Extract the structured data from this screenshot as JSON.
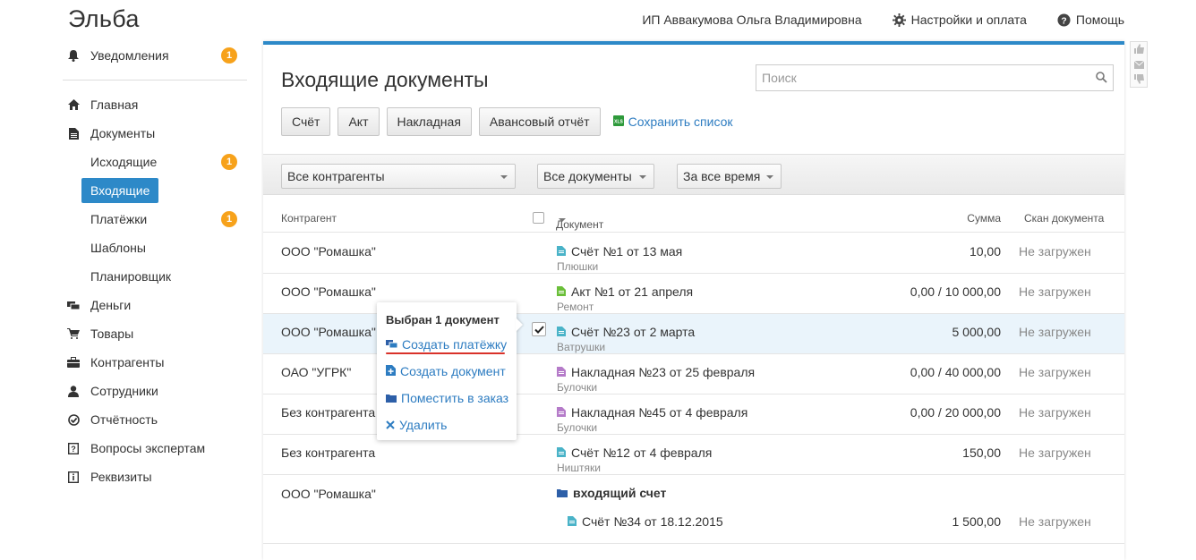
{
  "app": {
    "title": "Эльба"
  },
  "header": {
    "user_name": "ИП Аввакумова Ольга Владимировна",
    "settings_label": "Настройки и оплата",
    "help_label": "Помощь"
  },
  "sidebar": {
    "notifications": {
      "label": "Уведомления",
      "badge": "1"
    },
    "items": [
      {
        "label": "Главная",
        "icon": "home-icon"
      },
      {
        "label": "Документы",
        "icon": "document-icon"
      },
      {
        "label": "Исходящие",
        "badge": "1"
      },
      {
        "label": "Входящие",
        "active": true
      },
      {
        "label": "Платёжки",
        "badge": "1"
      },
      {
        "label": "Шаблоны"
      },
      {
        "label": "Планировщик"
      },
      {
        "label": "Деньги",
        "icon": "money-icon"
      },
      {
        "label": "Товары",
        "icon": "cart-icon"
      },
      {
        "label": "Контрагенты",
        "icon": "briefcase-icon"
      },
      {
        "label": "Сотрудники",
        "icon": "person-icon"
      },
      {
        "label": "Отчётность",
        "icon": "report-icon"
      },
      {
        "label": "Вопросы экспертам",
        "icon": "question-icon"
      },
      {
        "label": "Реквизиты",
        "icon": "info-icon"
      }
    ]
  },
  "main": {
    "title": "Входящие документы",
    "search_placeholder": "Поиск",
    "create_buttons": [
      "Счёт",
      "Акт",
      "Накладная",
      "Авансовый отчёт"
    ],
    "save_list_label": "Сохранить список",
    "filters": {
      "counterparty": "Все контрагенты",
      "documents": "Все документы",
      "period": "За все время"
    },
    "table": {
      "headers": {
        "counterparty": "Контрагент",
        "document": "Документ",
        "sum": "Сумма",
        "scan": "Скан документа"
      },
      "rows": [
        {
          "counterparty": "ООО \"Ромашка\"",
          "doc": "Счёт №1 от 13 мая",
          "desc": "Плюшки",
          "sum": "10,00",
          "scan": "Не загружен",
          "type": "invoice"
        },
        {
          "counterparty": "ООО \"Ромашка\"",
          "doc": "Акт №1 от 21 апреля",
          "desc": "Ремонт",
          "sum": "0,00 / 10 000,00",
          "scan": "Не загружен",
          "type": "act"
        },
        {
          "counterparty": "ООО \"Ромашка\"",
          "doc": "Счёт №23 от 2 марта",
          "desc": "Ватрушки",
          "sum": "5 000,00",
          "scan": "Не загружен",
          "type": "invoice",
          "selected": true
        },
        {
          "counterparty": "ОАО \"УГРК\"",
          "doc": "Накладная №23 от 25 февраля",
          "desc": "Булочки",
          "sum": "0,00 / 40 000,00",
          "scan": "Не загружен",
          "type": "waybill"
        },
        {
          "counterparty": "Без контрагента",
          "doc": "Накладная №45 от 4 февраля",
          "desc": "Булочки",
          "sum": "0,00 / 20 000,00",
          "scan": "Не загружен",
          "type": "waybill"
        },
        {
          "counterparty": "Без контрагента",
          "doc": "Счёт №12 от 4 февраля",
          "desc": "Ништяки",
          "sum": "150,00",
          "scan": "Не загружен",
          "type": "invoice"
        }
      ],
      "group_row": {
        "counterparty": "ООО \"Ромашка\"",
        "group_label": "входящий счет",
        "doc": "Счёт №34 от 18.12.2015",
        "sum": "1 500,00",
        "scan": "Не загружен"
      }
    }
  },
  "popup": {
    "title": "Выбран 1 документ",
    "actions": [
      "Создать платёжку",
      "Создать документ",
      "Поместить в заказ",
      "Удалить"
    ]
  },
  "colors": {
    "accent": "#2d89c8",
    "link": "#2d7cc1",
    "badge": "#f7a21b",
    "highlight_underline": "#d9322a",
    "invoice_icon": "#4ab3c8",
    "act_icon": "#6bbf3a",
    "waybill_icon": "#b57bc9"
  }
}
